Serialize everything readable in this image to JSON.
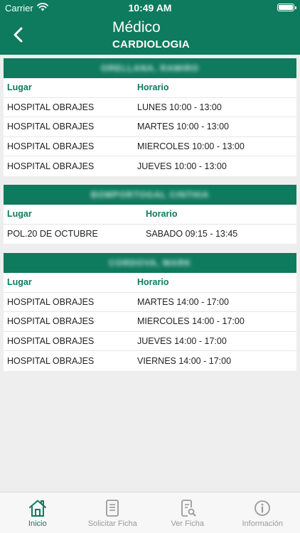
{
  "status_bar": {
    "carrier": "Carrier",
    "time": "10:49 AM"
  },
  "nav": {
    "title": "Médico",
    "subtitle": "CARDIOLOGIA"
  },
  "table_headers": {
    "lugar": "Lugar",
    "horario": "Horario"
  },
  "doctors": [
    {
      "name": "ORELLANA, RAMIRO",
      "rows": [
        {
          "lugar": "HOSPITAL OBRAJES",
          "horario": "LUNES 10:00 - 13:00"
        },
        {
          "lugar": "HOSPITAL OBRAJES",
          "horario": "MARTES 10:00 - 13:00"
        },
        {
          "lugar": "HOSPITAL OBRAJES",
          "horario": "MIERCOLES 10:00 - 13:00"
        },
        {
          "lugar": "HOSPITAL OBRAJES",
          "horario": "JUEVES 10:00 - 13:00"
        }
      ]
    },
    {
      "name": "BOMPORTOGAL CINTHIA",
      "rows": [
        {
          "lugar": "POL.20 DE OCTUBRE",
          "horario": "SABADO 09:15 - 13:45"
        }
      ]
    },
    {
      "name": "CORDOVA, MARK",
      "rows": [
        {
          "lugar": "HOSPITAL OBRAJES",
          "horario": "MARTES 14:00 - 17:00"
        },
        {
          "lugar": "HOSPITAL OBRAJES",
          "horario": "MIERCOLES 14:00 - 17:00"
        },
        {
          "lugar": "HOSPITAL OBRAJES",
          "horario": "JUEVES 14:00 - 17:00"
        },
        {
          "lugar": "HOSPITAL OBRAJES",
          "horario": "VIERNES 14:00 - 17:00"
        }
      ]
    }
  ],
  "tabs": [
    {
      "label": "Inicio",
      "icon": "home-icon",
      "active": true
    },
    {
      "label": "Solicitar Ficha",
      "icon": "document-icon",
      "active": false
    },
    {
      "label": "Ver Ficha",
      "icon": "document-search-icon",
      "active": false
    },
    {
      "label": "Información",
      "icon": "info-icon",
      "active": false
    }
  ],
  "colors": {
    "primary": "#0e7a5e",
    "background": "#eeeeee",
    "tab_inactive": "#9a9a9a"
  }
}
